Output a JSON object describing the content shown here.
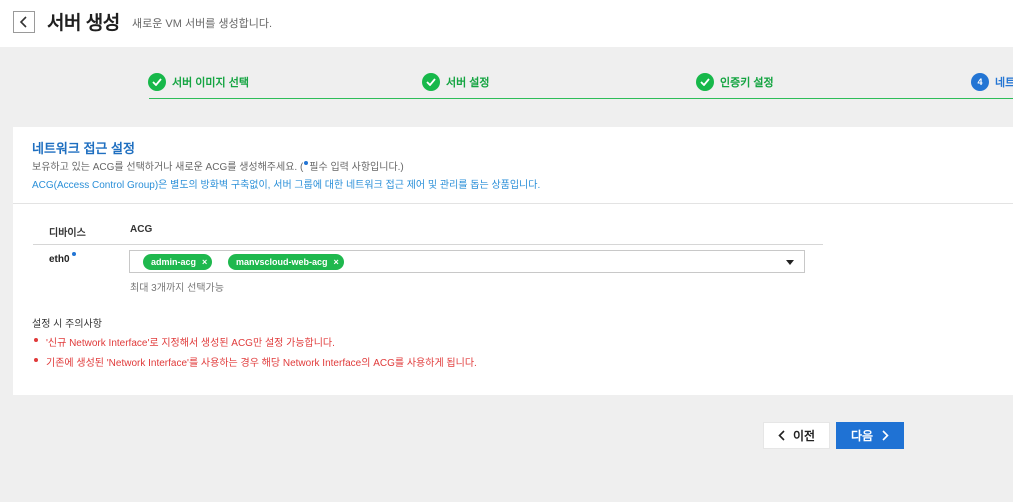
{
  "header": {
    "back_icon": "chevron-left-icon",
    "title": "서버 생성",
    "subtitle": "새로운 VM 서버를 생성합니다."
  },
  "stepper": {
    "steps": [
      {
        "label": "서버 이미지 선택",
        "status": "done",
        "icon": "check-icon"
      },
      {
        "label": "서버 설정",
        "status": "done",
        "icon": "check-icon"
      },
      {
        "label": "인증키 설정",
        "status": "done",
        "icon": "check-icon"
      },
      {
        "label": "네트",
        "status": "active",
        "number": "4"
      }
    ],
    "accent_color": "#17b84a",
    "active_color": "#2375d4"
  },
  "network": {
    "title": "네트워크 접근 설정",
    "desc_before": "보유하고 있는 ACG를 선택하거나 새로운 ACG를 생성해주세요. (",
    "desc_after": "필수 입력 사항입니다.)",
    "info": "ACG(Access Control Group)은 별도의 방화벽 구축없이, 서버 그룹에 대한 네트워크 접근 제어 및 관리를 돕는 상품입니다.",
    "table": {
      "headers": [
        "디바이스",
        "ACG"
      ],
      "rows": [
        {
          "device": "eth0",
          "acgs": [
            {
              "name": "admin-acg",
              "remove": "×"
            },
            {
              "name": "manvscloud-web-acg",
              "remove": "×"
            }
          ],
          "hint": "최대 3개까지 선택가능"
        }
      ]
    },
    "notice": {
      "title": "설정 시 주의사항",
      "items": [
        "'신규 Network Interface'로 지정해서 생성된 ACG만 설정 가능합니다.",
        "기존에 생성된 'Network Interface'를 사용하는 경우 해당 Network Interface의 ACG를 사용하게 됩니다."
      ],
      "color": "#e03a3a"
    }
  },
  "buttons": {
    "prev": "이전",
    "next": "다음",
    "next_color": "#1f72d4"
  }
}
